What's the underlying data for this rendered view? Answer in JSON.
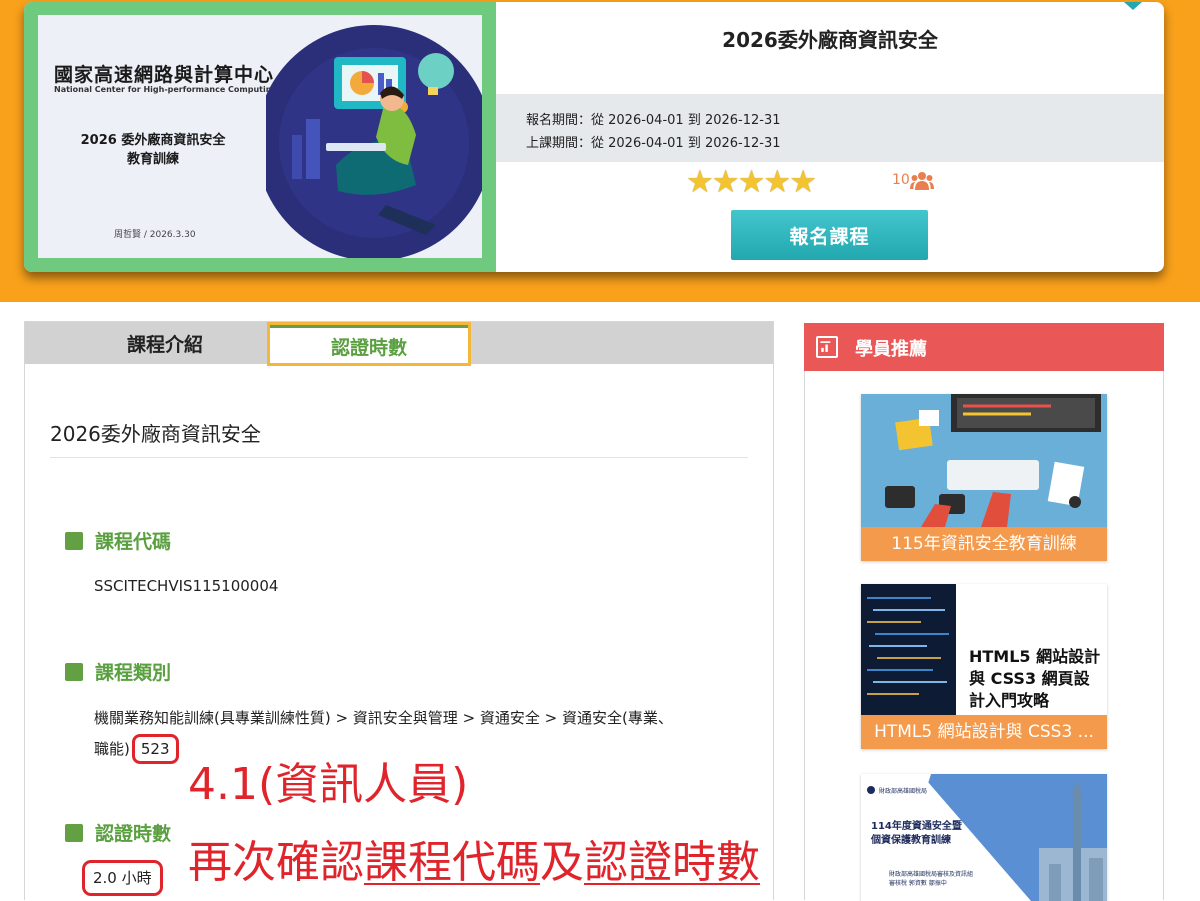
{
  "course_card": {
    "cover": {
      "org_name": "國家高速網路與計算中心",
      "org_name_en": "National Center for High-performance Computing",
      "title_line1": "2026 委外廠商資訊安全",
      "title_line2": "教育訓練",
      "author_date": "周哲賢 / 2026.3.30"
    },
    "title": "2026委外廠商資訊安全",
    "registration_period": "報名期間：從 2026-04-01 到 2026-12-31",
    "class_period": "上課期間：從 2026-04-01 到 2026-12-31",
    "rating": {
      "stars": 5,
      "max": 5,
      "star_glyph": "★"
    },
    "rating_count": "10",
    "enroll_label": "報名課程",
    "colors": {
      "banner": "#f9a11b",
      "cover_frame": "#6fca80",
      "enroll": "#2fb3bb"
    }
  },
  "tabs": [
    {
      "label": "課程介紹",
      "active": false
    },
    {
      "label": "認證時數",
      "active": true
    }
  ],
  "main": {
    "course_name": "2026委外廠商資訊安全",
    "sections": {
      "code": {
        "heading": "課程代碼",
        "value": "SSCITECHVIS115100004"
      },
      "category": {
        "heading": "課程類別",
        "line1": "機關業務知能訓練(具專業訓練性質) > 資訊安全與管理 > 資通安全 > 資通安全(專業、",
        "line2_prefix": "職能)",
        "code_highlight": "523"
      },
      "hours": {
        "heading": "認證時數",
        "value": "2.0 小時"
      }
    }
  },
  "annotations": {
    "note1": "4.1(資訊人員)",
    "note2_part1": "再次確認",
    "note2_part2": "課程代碼",
    "note2_part3": "及",
    "note2_part4": "認證時數",
    "color": "#e0242b"
  },
  "sidebar": {
    "title": "學員推薦",
    "items": [
      {
        "caption": "115年資訊安全教育訓練"
      },
      {
        "caption": "HTML5 網站設計與 CSS3 ...",
        "thumb_text": "HTML5 網站設計與 CSS3 網頁設計入門攻略"
      },
      {
        "caption": "",
        "thumb_org": "財政部高雄國稅局",
        "thumb_title_line1": "114年度資通安全暨",
        "thumb_title_line2": "個資保護教育訓練",
        "thumb_footer_line1": "財政部高雄國稅局審核及資訊組",
        "thumb_footer_line2": "審核稅    郭資數    鄒振中"
      }
    ],
    "colors": {
      "header": "#e95757",
      "caption_bg": "#f39a4c"
    }
  }
}
